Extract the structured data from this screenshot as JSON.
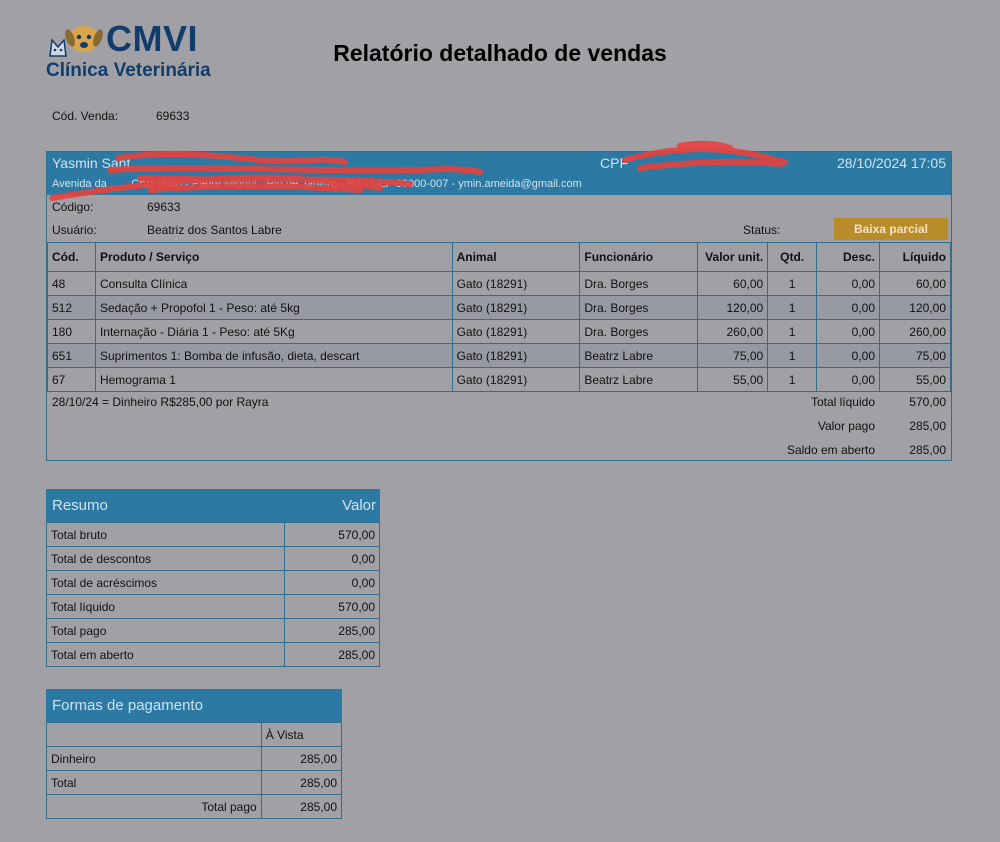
{
  "brand": {
    "name": "CMVI",
    "subtitle": "Clínica Veterinária",
    "color": "#123c6c"
  },
  "title": "Relatório detalhado de vendas",
  "sale": {
    "code_label": "Cód. Venda:",
    "code_value": "69633",
    "client_name": "Yasmin Sant",
    "cpf_label": "CPF",
    "datetime": "28/10/2024 17:05",
    "address": "Avenida da ...... Cruz 0000 - Padre Miguel - Rio de Janeiro - RJ - CEP 00000-007 - ymin.ameida@gmail.com",
    "codigo_label": "Código:",
    "codigo_value": "69633",
    "usuario_label": "Usuário:",
    "usuario_value": "Beatriz dos Santos Labre",
    "status_label": "Status:",
    "status_value": "Baixa parcial",
    "status_color": "#b98c2a"
  },
  "items_table": {
    "headers": [
      "Cód.",
      "Produto / Serviço",
      "Animal",
      "Funcionário",
      "Valor unit.",
      "Qtd.",
      "Desc.",
      "Líquido"
    ],
    "rows": [
      [
        "48",
        "Consulta Clínica",
        "Gato (18291)",
        "Dra. Borges",
        "60,00",
        "1",
        "0,00",
        "60,00"
      ],
      [
        "512",
        "Sedação + Propofol 1 - Peso: até 5kg",
        "Gato (18291)",
        "Dra. Borges",
        "120,00",
        "1",
        "0,00",
        "120,00"
      ],
      [
        "180",
        "Internação - Diária 1 - Peso: até 5Kg",
        "Gato (18291)",
        "Dra. Borges",
        "260,00",
        "1",
        "0,00",
        "260,00"
      ],
      [
        "651",
        "Suprimentos 1: Bomba de infusão, dieta, descart",
        "Gato (18291)",
        "Beatrz Labre",
        "75,00",
        "1",
        "0,00",
        "75,00"
      ],
      [
        "67",
        "Hemograma 1",
        "Gato (18291)",
        "Beatrz Labre",
        "55,00",
        "1",
        "0,00",
        "55,00"
      ]
    ]
  },
  "payment_note": "28/10/24 = Dinheiro R$285,00 por Rayra",
  "totals": [
    {
      "label": "Total líquido",
      "value": "570,00"
    },
    {
      "label": "Valor pago",
      "value": "285,00"
    },
    {
      "label": "Saldo em aberto",
      "value": "285,00"
    }
  ],
  "resumo": {
    "title": "Resumo",
    "value_header": "Valor",
    "rows": [
      {
        "label": "Total bruto",
        "value": "570,00"
      },
      {
        "label": "Total de descontos",
        "value": "0,00"
      },
      {
        "label": "Total de acréscimos",
        "value": "0,00"
      },
      {
        "label": "Total líquido",
        "value": "570,00"
      },
      {
        "label": "Total pago",
        "value": "285,00"
      },
      {
        "label": "Total em aberto",
        "value": "285,00"
      }
    ]
  },
  "formas": {
    "title": "Formas de pagamento",
    "column": "À Vista",
    "rows": [
      {
        "label": "Dinheiro",
        "value": "285,00"
      },
      {
        "label": "Total",
        "value": "285,00"
      }
    ],
    "total_pago_label": "Total pago",
    "total_pago_value": "285,00"
  },
  "colors": {
    "background": "#a1a1a5",
    "header_blue": "#2c7aa3",
    "border_blue": "#2f6e8e",
    "redaction": "#e8413e"
  }
}
